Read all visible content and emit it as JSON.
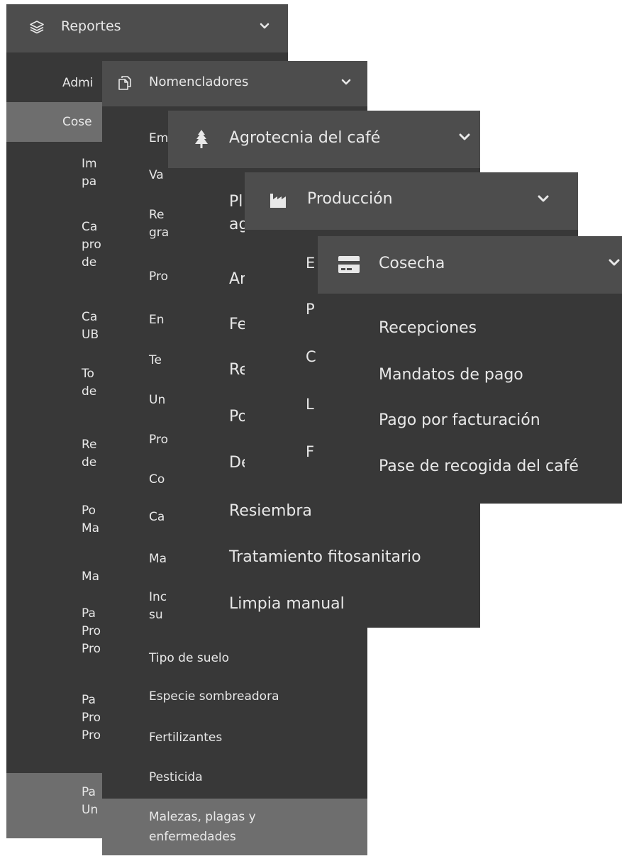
{
  "reportes": {
    "title": "Reportes",
    "items": [
      "Admi",
      "Cose",
      "Im\npa",
      "Ca\npro\nde",
      "Ca\nUB",
      "To\nde",
      "Re\nde",
      "Po\nMa",
      "Ma",
      "Pa\nPro\nPro",
      "Pa\nPro\nPro",
      "Pa\nUn"
    ]
  },
  "nomencladores": {
    "title": "Nomencladores",
    "items": [
      "Em",
      "Va",
      "Re\ngra",
      "Pro",
      "En",
      "Te",
      "Un",
      "Pro",
      "Co",
      "Ca",
      "Ma",
      "Inc\nsu",
      "Tipo de suelo",
      "Especie sombreadora",
      "Fertilizantes",
      "Pesticida",
      "Malezas, plagas y\nenfermedades"
    ]
  },
  "agrotecnia": {
    "title": "Agrotecnia del café",
    "items": [
      "Pl\nag",
      "Ar",
      "Fe",
      "Re",
      "Po",
      "De",
      "Resiembra",
      "Tratamiento fitosanitario",
      "Limpia manual"
    ]
  },
  "produccion": {
    "title": "Producción",
    "items": [
      "E",
      "P",
      "C",
      "L",
      "F"
    ]
  },
  "cosecha": {
    "title": "Cosecha",
    "items": [
      "Recepciones",
      "Mandatos de pago",
      "Pago por facturación",
      "Pase de recogida del café"
    ]
  },
  "icons": {
    "reportes": "layers-icon",
    "nomencladores": "document-copy-icon",
    "agrotecnia": "tree-icon",
    "produccion": "industry-icon",
    "cosecha": "credit-card-icon",
    "chevron": "chevron-down-icon"
  },
  "colors": {
    "panel_bg": "#383838",
    "header_bg": "#4d4d4d",
    "selected_bg": "#6e6e6e",
    "text": "#e8e8e8"
  }
}
